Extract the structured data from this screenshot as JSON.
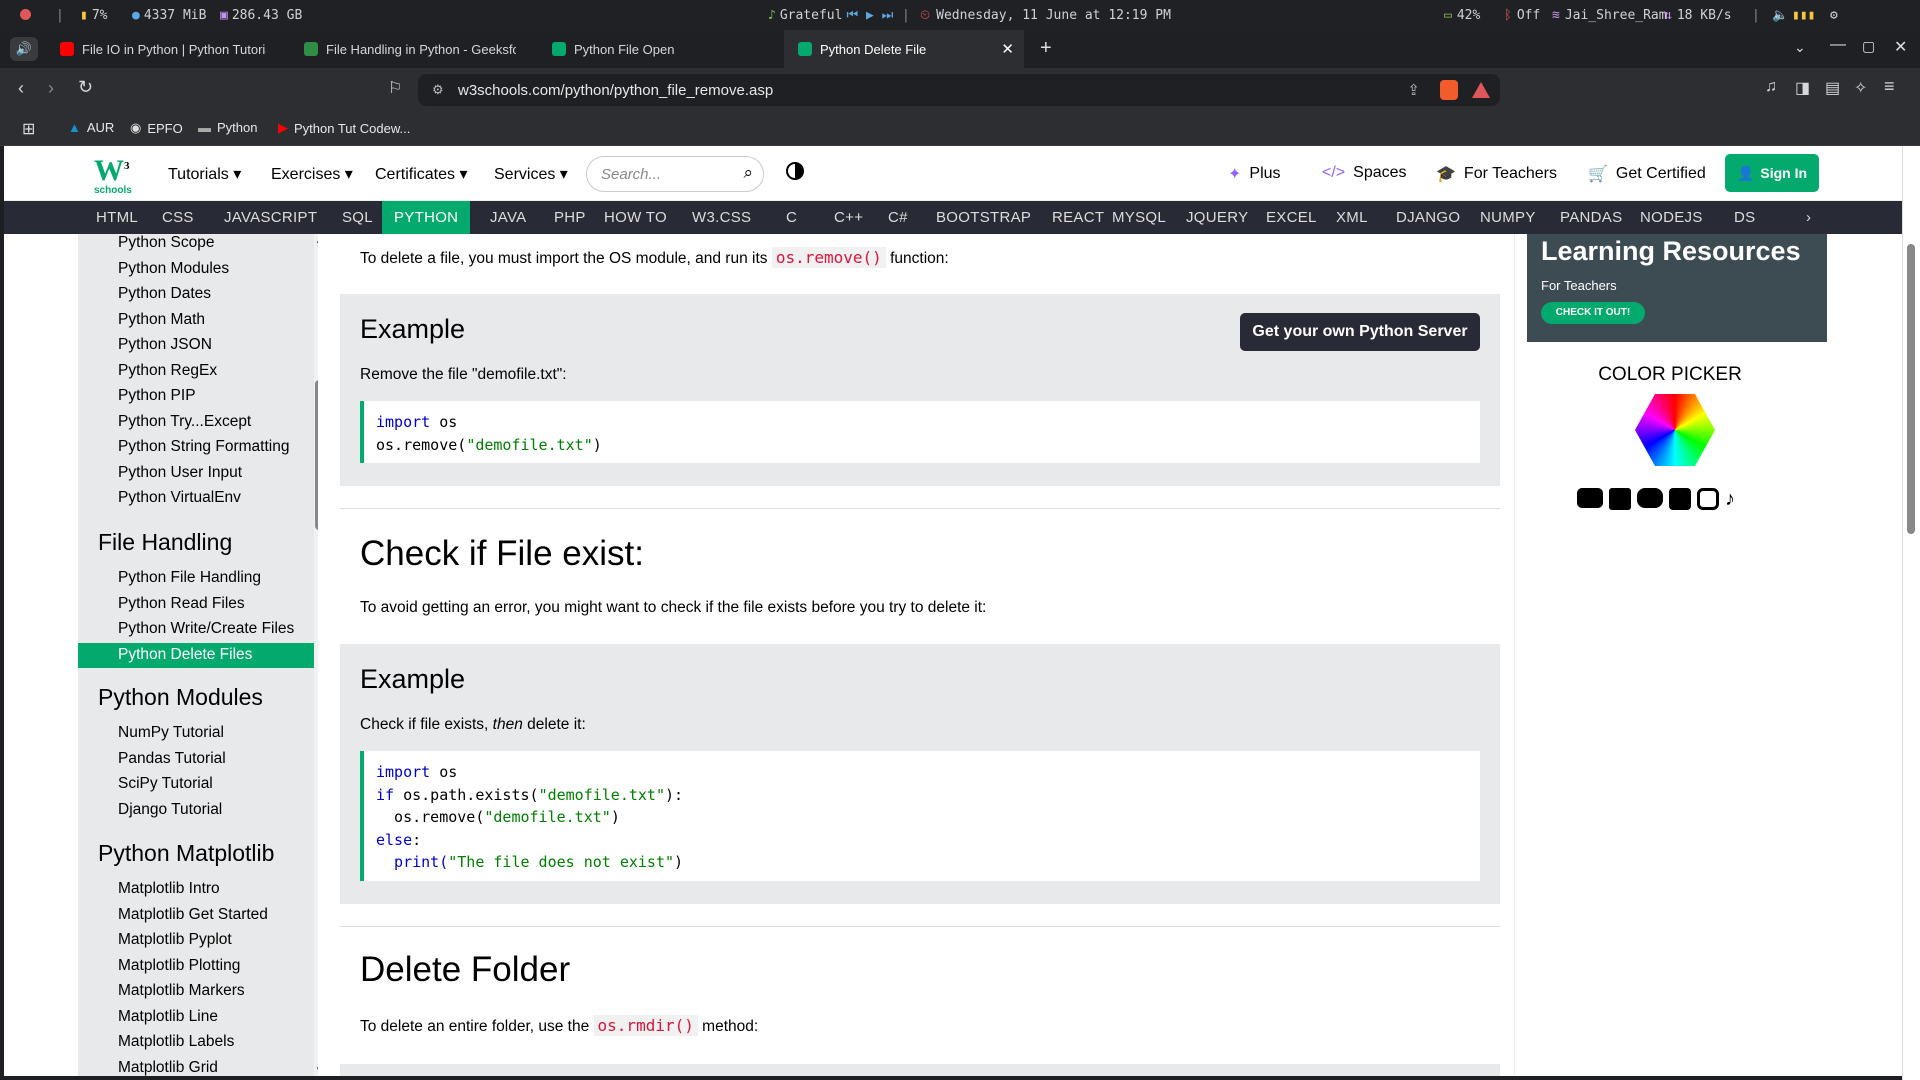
{
  "status_bar": {
    "cpu": "7%",
    "mem": "4337 MiB",
    "disk": "286.43 GB",
    "music": "Grateful",
    "datetime": "Wednesday, 11 June at 12:19 PM",
    "battery": "42%",
    "bt": "Off",
    "wifi": "Jai_Shree_Ram",
    "net": "18 KB/s"
  },
  "tabs": [
    {
      "label": "File IO in Python | Python Tutorial",
      "color": "#ff0000"
    },
    {
      "label": "File Handling in Python - GeeksforG",
      "color": "#2f8d46"
    },
    {
      "label": "Python File Open",
      "color": "#04aa6d"
    },
    {
      "label": "Python Delete File",
      "color": "#04aa6d"
    }
  ],
  "url": "w3schools.com/python/python_file_remove.asp",
  "bookmarks": [
    "AUR",
    "EPFO",
    "Python",
    "Python Tut Codew..."
  ],
  "w3": {
    "logo_sub": "schools",
    "menus": [
      "Tutorials",
      "Exercises",
      "Certificates",
      "Services"
    ],
    "search_placeholder": "Search...",
    "right_links": [
      "Plus",
      "Spaces",
      "For Teachers",
      "Get Certified"
    ],
    "sign_in": "Sign In",
    "topnav": [
      "HTML",
      "CSS",
      "JAVASCRIPT",
      "SQL",
      "PYTHON",
      "JAVA",
      "PHP",
      "HOW TO",
      "W3.CSS",
      "C",
      "C++",
      "C#",
      "BOOTSTRAP",
      "REACT",
      "MYSQL",
      "JQUERY",
      "EXCEL",
      "XML",
      "DJANGO",
      "NUMPY",
      "PANDAS",
      "NODEJS",
      "DS"
    ],
    "topnav_active": "PYTHON"
  },
  "sidebar": {
    "items_top": [
      "Python Scope",
      "Python Modules",
      "Python Dates",
      "Python Math",
      "Python JSON",
      "Python RegEx",
      "Python PIP",
      "Python Try...Except",
      "Python String Formatting",
      "Python User Input",
      "Python VirtualEnv"
    ],
    "h_file": "File Handling",
    "items_file": [
      "Python File Handling",
      "Python Read Files",
      "Python Write/Create Files",
      "Python Delete Files"
    ],
    "h_modules": "Python Modules",
    "items_modules": [
      "NumPy Tutorial",
      "Pandas Tutorial",
      "SciPy Tutorial",
      "Django Tutorial"
    ],
    "h_matplotlib": "Python Matplotlib",
    "items_matplotlib": [
      "Matplotlib Intro",
      "Matplotlib Get Started",
      "Matplotlib Pyplot",
      "Matplotlib Plotting",
      "Matplotlib Markers",
      "Matplotlib Line",
      "Matplotlib Labels",
      "Matplotlib Grid"
    ]
  },
  "main": {
    "intro_pre": "To delete a file, you must import the OS module, and run its",
    "intro_code": "os.remove()",
    "intro_post": "function:",
    "ex1_title": "Example",
    "server_btn": "Get your own Python Server",
    "ex1_desc": "Remove the file \"demofile.txt\":",
    "ex1_code_l1_kw": "import",
    "ex1_code_l1_rest": " os",
    "ex1_code_l2_pre": "os.remove(",
    "ex1_code_l2_str": "\"demofile.txt\"",
    "ex1_code_l2_post": ")",
    "h_check": "Check if File exist:",
    "check_desc": "To avoid getting an error, you might want to check if the file exists before you try to delete it:",
    "ex2_title": "Example",
    "ex2_desc_pre": "Check if file exists,",
    "ex2_desc_em": "then",
    "ex2_desc_post": "delete it:",
    "ex2_l1_kw": "import",
    "ex2_l1_rest": " os",
    "ex2_l2_kw": "if",
    "ex2_l2_pre": " os.path.exists(",
    "ex2_l2_str": "\"demofile.txt\"",
    "ex2_l2_post": "):",
    "ex2_l3_pre": "  os.remove(",
    "ex2_l3_str": "\"demofile.txt\"",
    "ex2_l3_post": ")",
    "ex2_l4_kw": "else",
    "ex2_l4_post": ":",
    "ex2_l5_pre": "  print(",
    "ex2_l5_str": "\"The file does not exist\"",
    "ex2_l5_post": ")",
    "h_folder": "Delete Folder",
    "folder_pre": "To delete an entire folder, use the",
    "folder_code": "os.rmdir()",
    "folder_post": "method:"
  },
  "right": {
    "ad_title": "Learning Resources",
    "ad_sub": "For Teachers",
    "ad_btn": "CHECK IT OUT!",
    "color_picker": "COLOR PICKER"
  }
}
